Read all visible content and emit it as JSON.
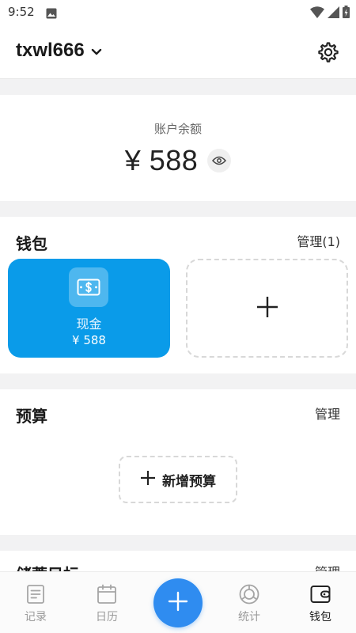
{
  "status_bar": {
    "time": "9:52"
  },
  "header": {
    "account_name": "txwl666"
  },
  "balance": {
    "label": "账户余额",
    "amount": "¥ 588"
  },
  "wallet": {
    "title": "钱包",
    "manage_label": "管理(1)",
    "items": [
      {
        "name": "现金",
        "amount": "¥ 588",
        "color": "#0a9be9"
      }
    ]
  },
  "budget": {
    "title": "预算",
    "manage_label": "管理",
    "add_label": "新增预算"
  },
  "savings": {
    "title": "储蓄目标",
    "manage_label": "管理"
  },
  "bottom_nav": {
    "items": [
      {
        "label": "记录",
        "icon": "document-icon",
        "active": false
      },
      {
        "label": "日历",
        "icon": "calendar-icon",
        "active": false
      },
      {
        "label": "统计",
        "icon": "chart-ring-icon",
        "active": false
      },
      {
        "label": "钱包",
        "icon": "wallet-icon",
        "active": true
      }
    ],
    "fab_color": "#2f8cf0"
  }
}
